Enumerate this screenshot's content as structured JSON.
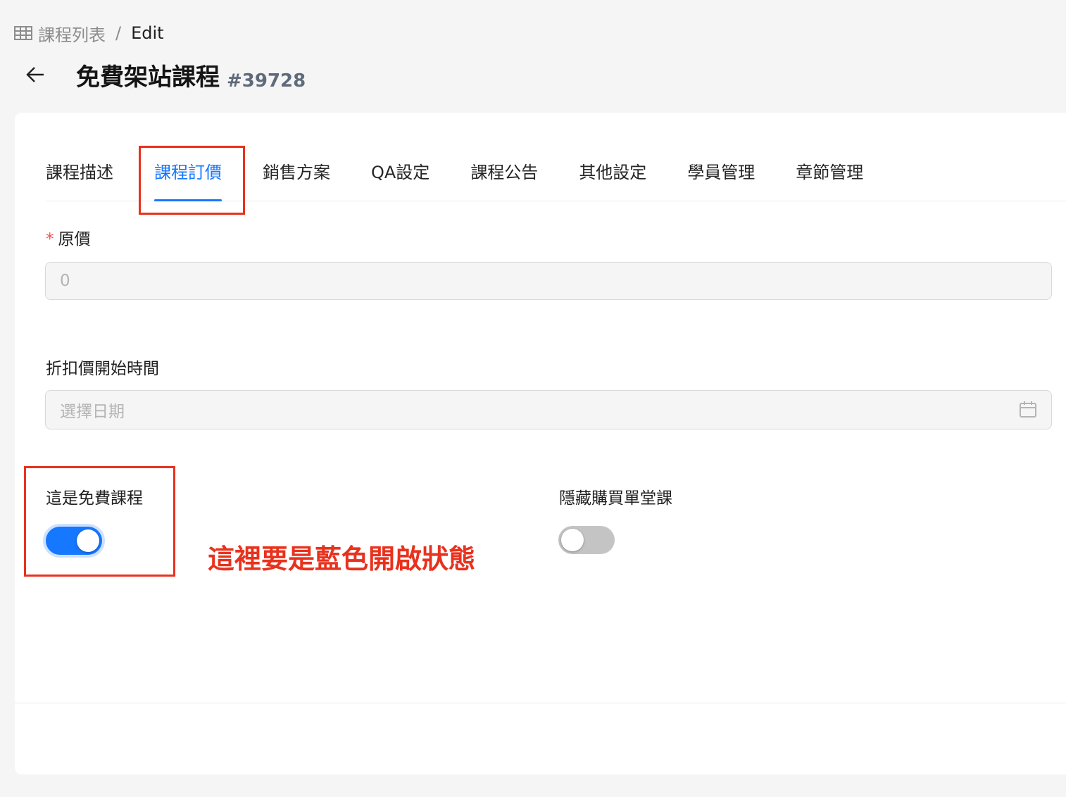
{
  "breadcrumb": {
    "icon": "table-icon",
    "parent": "課程列表",
    "separator": "/",
    "current": "Edit"
  },
  "header": {
    "back_icon": "arrow-left-icon",
    "title": "免費架站課程",
    "id": "#39728"
  },
  "tabs": [
    {
      "label": "課程描述",
      "active": false
    },
    {
      "label": "課程訂價",
      "active": true
    },
    {
      "label": "銷售方案",
      "active": false
    },
    {
      "label": "QA設定",
      "active": false
    },
    {
      "label": "課程公告",
      "active": false
    },
    {
      "label": "其他設定",
      "active": false
    },
    {
      "label": "學員管理",
      "active": false
    },
    {
      "label": "章節管理",
      "active": false
    }
  ],
  "form": {
    "original_price": {
      "required_mark": "*",
      "label": "原價",
      "value": "0"
    },
    "discount_start": {
      "label": "折扣價開始時間",
      "placeholder": "選擇日期",
      "icon": "calendar-icon"
    },
    "is_free": {
      "label": "這是免費課程",
      "checked": true
    },
    "hide_single": {
      "label": "隱藏購買單堂課",
      "checked": false
    }
  },
  "annotation": {
    "text": "這裡要是藍色開啟狀態",
    "color": "#e8321e"
  },
  "colors": {
    "primary": "#1677ff",
    "annotation": "#e8321e"
  }
}
